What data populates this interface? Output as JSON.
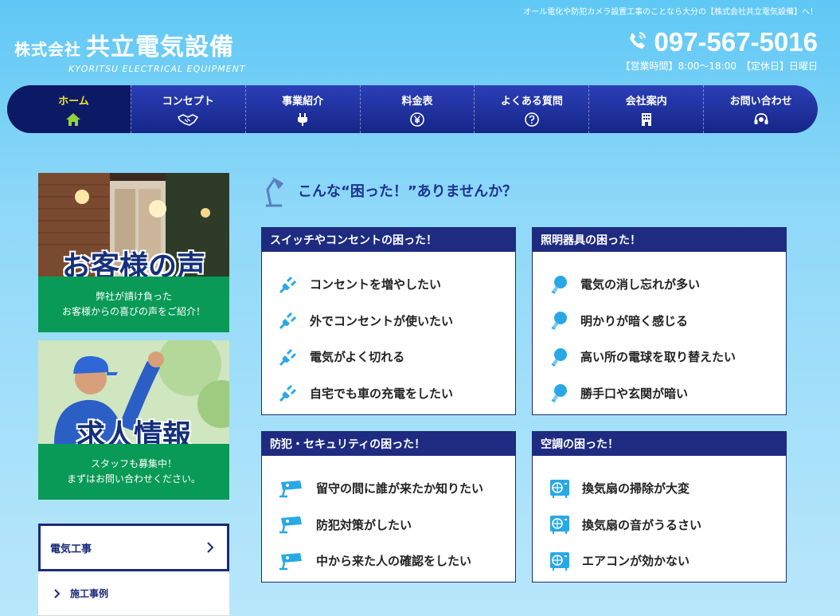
{
  "header": {
    "tagline": "オール電化や防犯カメラ設置工事のことなら大分の【株式会社共立電気設備】へ！",
    "logo_prefix": "株式会社",
    "logo_name": "共立電気設備",
    "logo_sub": "KYORITSU ELECTRICAL EQUIPMENT",
    "phone": "097-567-5016",
    "hours": "【営業時間】8:00～18:00　【定休日】日曜日"
  },
  "nav": {
    "items": [
      {
        "label": "ホーム",
        "icon": "home-icon",
        "active": true
      },
      {
        "label": "コンセプト",
        "icon": "handshake-icon"
      },
      {
        "label": "事業紹介",
        "icon": "plug-icon"
      },
      {
        "label": "料金表",
        "icon": "yen-icon"
      },
      {
        "label": "よくある質問",
        "icon": "question-icon"
      },
      {
        "label": "会社案内",
        "icon": "building-icon"
      },
      {
        "label": "お問い合わせ",
        "icon": "headset-icon"
      }
    ]
  },
  "sidebar": {
    "voice_banner": {
      "title": "お客様の声",
      "line1": "弊社が請け負った",
      "line2": "お客様からの喜びの声をご紹介！"
    },
    "recruit_banner": {
      "title": "求人情報",
      "line1": "スタッフも募集中！",
      "line2": "まずはお問い合わせください。"
    },
    "menu": {
      "main": "電気工事",
      "sub": "施工事例"
    }
  },
  "main": {
    "title": "こんな“困った！”ありませんか？",
    "boxes": [
      {
        "heading": "スイッチやコンセントの困った！",
        "icon": "plug-icon",
        "items": [
          "コンセントを増やしたい",
          "外でコンセントが使いたい",
          "電気がよく切れる",
          "自宅でも車の充電をしたい"
        ]
      },
      {
        "heading": "照明器具の困った！",
        "icon": "bulb-icon",
        "items": [
          "電気の消し忘れが多い",
          "明かりが暗く感じる",
          "高い所の電球を取り替えたい",
          "勝手口や玄関が暗い"
        ]
      },
      {
        "heading": "防犯・セキュリティの困った！",
        "icon": "camera-icon",
        "items": [
          "留守の間に誰が来たか知りたい",
          "防犯対策がしたい",
          "中から来た人の確認をしたい"
        ]
      },
      {
        "heading": "空調の困った！",
        "icon": "aircon-icon",
        "items": [
          "換気扇の掃除が大変",
          "換気扇の音がうるさい",
          "エアコンが効かない"
        ]
      }
    ]
  },
  "colors": {
    "nav": "#1a2a90",
    "accent": "#f5e31f",
    "green": "#099a57",
    "icon": "#29a8e6"
  }
}
